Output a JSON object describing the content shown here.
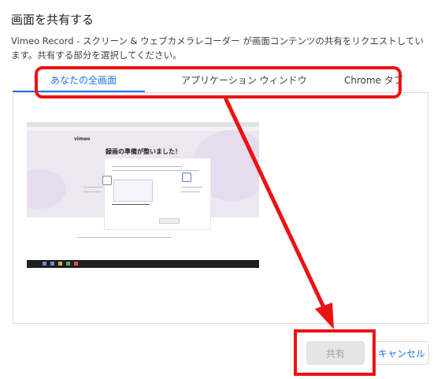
{
  "dialog": {
    "title": "画面を共有する",
    "description": "Vimeo Record - スクリーン & ウェブカメラレコーダー が画面コンテンツの共有をリクエストしています。共有する部分を選択してください。"
  },
  "tabs": [
    {
      "label": "あなたの全画面",
      "active": true
    },
    {
      "label": "アプリケーション ウィンドウ",
      "active": false
    },
    {
      "label": "Chrome タブ",
      "active": false
    }
  ],
  "preview": {
    "logo_text": "vimeo",
    "heading_text": "録画の準備が整いました！"
  },
  "buttons": {
    "share_label": "共有",
    "cancel_label": "キャンセル"
  },
  "colors": {
    "accent": "#1a73e8",
    "annotation_red": "#ee1111",
    "disabled_button_bg": "#e6e6e6"
  }
}
